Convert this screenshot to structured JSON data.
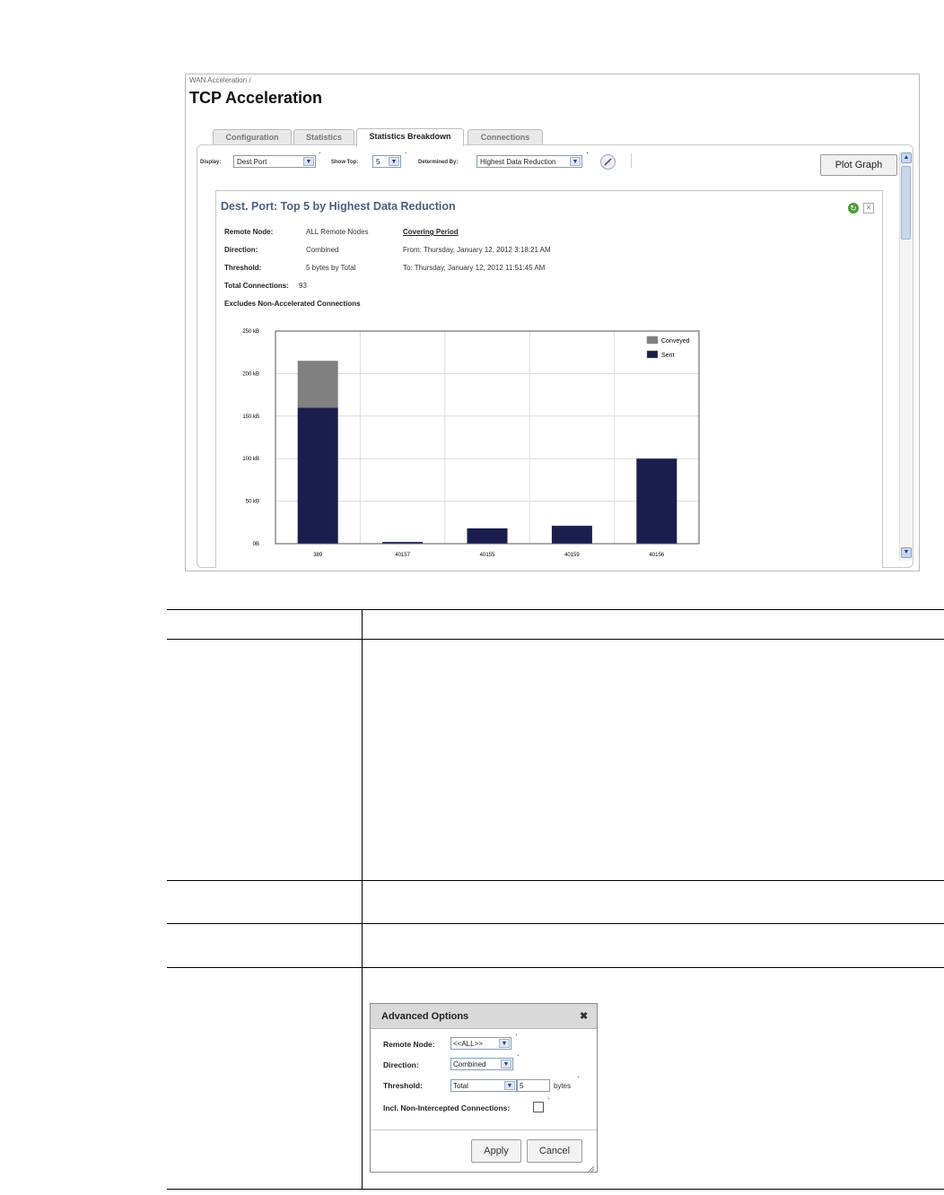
{
  "breadcrumb": "WAN Acceleration /",
  "page_title": "TCP Acceleration",
  "tabs": [
    {
      "label": "Configuration"
    },
    {
      "label": "Statistics"
    },
    {
      "label": "Statistics Breakdown",
      "active": true
    },
    {
      "label": "Connections"
    }
  ],
  "toolbar": {
    "display_label": "Display:",
    "display_value": "Dest Port",
    "show_top_label": "Show Top:",
    "show_top_value": "5",
    "determined_by_label": "Determined By:",
    "determined_by_value": "Highest Data Reduction",
    "plot_graph_label": "Plot Graph"
  },
  "report": {
    "title": "Dest. Port: Top 5 by Highest Data Reduction",
    "remote_node_key": "Remote Node:",
    "remote_node_value": "ALL Remote Nodes",
    "direction_key": "Direction:",
    "direction_value": "Combined",
    "threshold_key": "Threshold:",
    "threshold_value": "5 bytes by Total",
    "total_connections_key": "Total Connections:",
    "total_connections_value": "93",
    "excludes_note": "Excludes Non-Accelerated Connections",
    "covering_period": "Covering Period",
    "from": "From: Thursday, January 12, 2012 3:18:21 AM",
    "to": "To: Thursday, January 12, 2012 11:51:45 AM"
  },
  "chart_data": {
    "type": "bar",
    "stacked": true,
    "categories": [
      "389",
      "40157",
      "40155",
      "40159",
      "40156"
    ],
    "series": [
      {
        "name": "Sent",
        "values": [
          160,
          2,
          18,
          21,
          100
        ],
        "color": "#1a1e4e"
      },
      {
        "name": "Conveyed",
        "values": [
          55,
          0,
          0,
          0,
          0
        ],
        "color": "#808080"
      }
    ],
    "y_ticks": [
      "0B",
      "50 kB",
      "100 kB",
      "150 kB",
      "200 kB",
      "250 kB"
    ],
    "ylim": [
      0,
      250
    ],
    "grid": true,
    "legend_position": "top-right"
  },
  "advanced_options": {
    "title": "Advanced Options",
    "close_glyph": "✖",
    "remote_node_label": "Remote Node:",
    "remote_node_value": "<<ALL>>",
    "direction_label": "Direction:",
    "direction_value": "Combined",
    "threshold_label": "Threshold:",
    "threshold_type_value": "Total",
    "threshold_amount_value": "5",
    "threshold_unit": "bytes",
    "incl_label": "Incl. Non-Intercepted Connections:",
    "apply_label": "Apply",
    "cancel_label": "Cancel"
  }
}
